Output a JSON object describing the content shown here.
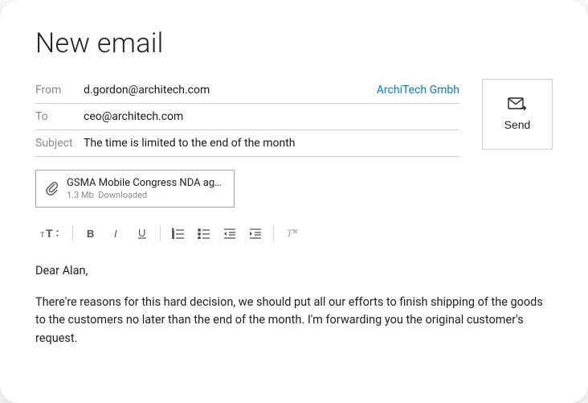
{
  "title": "New email",
  "fields": {
    "from_label": "From",
    "from_value": "d.gordon@architech.com",
    "account_name": "ArchiTech Gmbh",
    "to_label": "To",
    "to_value": "ceo@architech.com",
    "subject_label": "Subject",
    "subject_value": "The time is limited to the end of the month"
  },
  "send": {
    "label": "Send"
  },
  "attachment": {
    "name": "GSMA Mobile Congress NDA ag…",
    "size": "1.3 Mb",
    "status": "Downloaded"
  },
  "toolbar": {
    "font_size": "font-size",
    "bold": "bold",
    "italic": "italic",
    "underline": "underline",
    "list_ordered": "ordered-list",
    "list_bullet": "bullet-list",
    "outdent": "decrease-indent",
    "indent": "increase-indent",
    "clear_format": "clear-formatting"
  },
  "body": {
    "greeting": "Dear Alan,",
    "paragraph1": "There're reasons for this hard decision, we should put all our efforts to finish shipping of the goods to the customers no later than the end of the month.  I'm forwarding you the original customer's request."
  }
}
